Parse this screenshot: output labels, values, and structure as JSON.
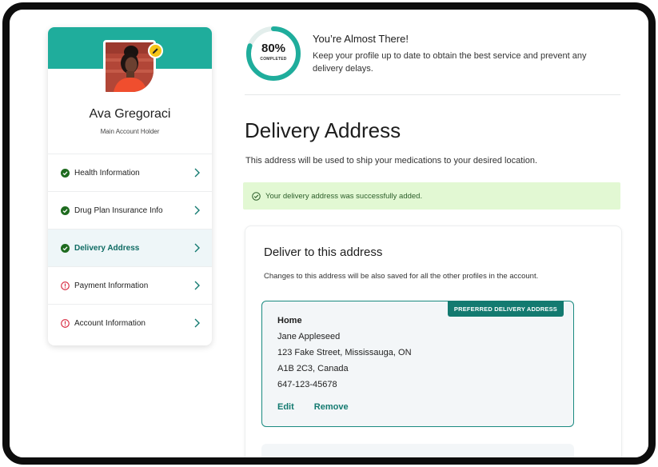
{
  "colors": {
    "brand": "#1fad9c",
    "accent": "#137a70",
    "success_bg": "#e2f8d3",
    "success_icon": "#1e6b1f",
    "warning": "#d7263d",
    "badge": "#f5c518"
  },
  "profile": {
    "name": "Ava Gregoraci",
    "role": "Main Account Holder",
    "edit_icon": "pencil-icon"
  },
  "nav": {
    "items": [
      {
        "label": "Health Information",
        "status": "complete"
      },
      {
        "label": "Drug Plan Insurance Info",
        "status": "complete"
      },
      {
        "label": "Delivery Address",
        "status": "complete",
        "active": true
      },
      {
        "label": "Payment Information",
        "status": "incomplete"
      },
      {
        "label": "Account Information",
        "status": "incomplete"
      }
    ]
  },
  "progress": {
    "percent_label": "80%",
    "percent": 80,
    "sub_label": "COMPLETED",
    "title": "You’re Almost There!",
    "text": "Keep your profile up to date to obtain the best service  and prevent any delivery delays."
  },
  "page": {
    "title": "Delivery Address",
    "description": "This address will be used to ship your medications to your desired location."
  },
  "alert": {
    "text": "Your delivery address was successfully added."
  },
  "panel": {
    "title": "Deliver to this address",
    "description": "Changes to this address will be also saved for all the other profiles in the account."
  },
  "address": {
    "badge": "PREFERRED DELIVERY ADDRESS",
    "label": "Home",
    "name": "Jane Appleseed",
    "street": "123 Fake Street, Mississauga, ON",
    "postal": "A1B 2C3, Canada",
    "phone": "647-123-45678",
    "edit_label": "Edit",
    "remove_label": "Remove"
  }
}
